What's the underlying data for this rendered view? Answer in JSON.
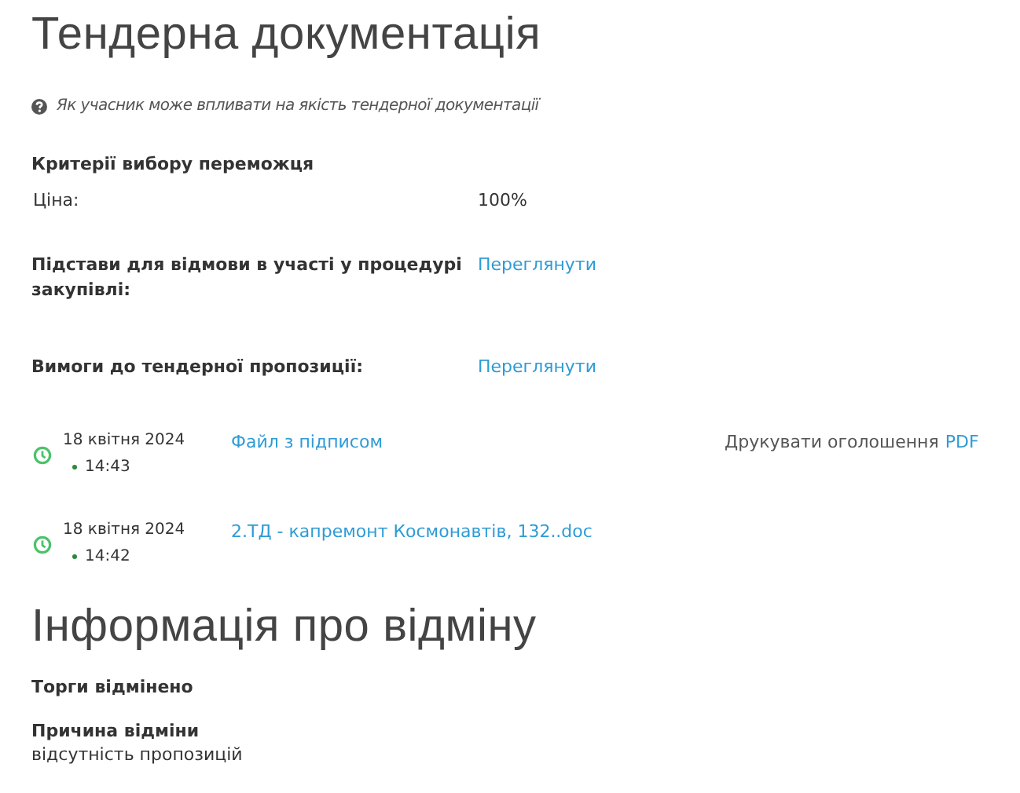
{
  "title": "Тендерна документація",
  "help_link": "Як учасник може впливати на якість тендерної документації",
  "criteria": {
    "heading": "Критерії вибору переможця",
    "rows": [
      {
        "label": "Ціна:",
        "value": "100%"
      }
    ]
  },
  "details": [
    {
      "label": "Підстави для відмови в участі у процедурі закупівлі:",
      "link": "Переглянути"
    },
    {
      "label": "Вимоги до тендерної пропозиції:",
      "link": "Переглянути"
    }
  ],
  "documents": [
    {
      "date": "18 квітня 2024",
      "time": "14:43",
      "file": "Файл з підписом",
      "print_label": "Друкувати оголошення",
      "print_link": "PDF"
    },
    {
      "date": "18 квітня 2024",
      "time": "14:42",
      "file": "2.ТД - капремонт Космонавтів, 132..doc"
    }
  ],
  "cancellation": {
    "title": "Інформація про відміну",
    "status": "Торги відмінено",
    "reason_label": "Причина відміни",
    "reason": "відсутність пропозицій"
  }
}
